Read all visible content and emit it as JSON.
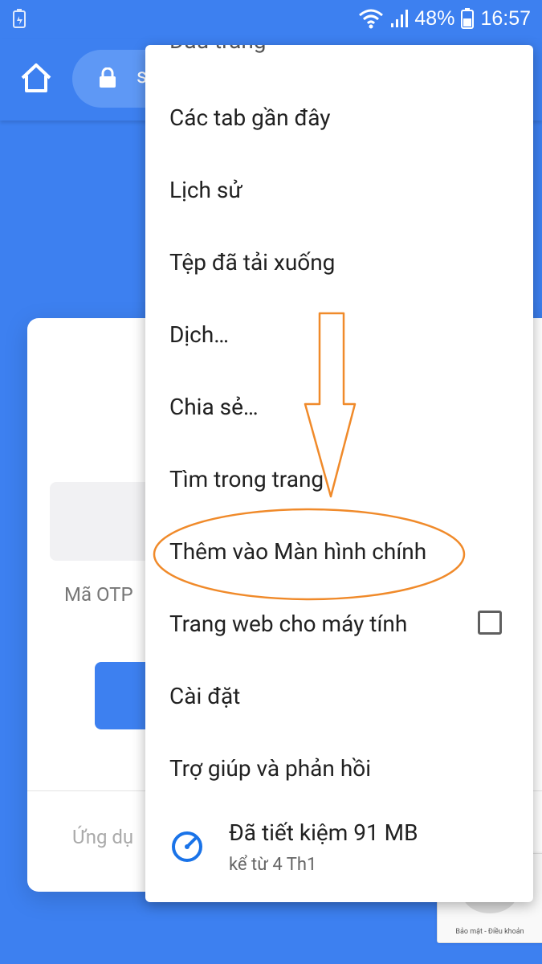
{
  "status_bar": {
    "battery": "48%",
    "time": "16:57"
  },
  "toolbar": {
    "url_fragment": "s"
  },
  "page": {
    "otp_label": "Mã OTP",
    "footer_text": "Ứng dụ"
  },
  "menu": {
    "partial_item": "Dấu trang",
    "items": [
      "Các tab gần đây",
      "Lịch sử",
      "Tệp đã tải xuống",
      "Dịch…",
      "Chia sẻ…",
      "Tìm trong trang",
      "Thêm vào Màn hình chính",
      "Trang web cho máy tính",
      "Cài đặt",
      "Trợ giúp và phản hồi"
    ],
    "savings_title": "Đã tiết kiệm 91 MB",
    "savings_subtitle": "kể từ 4 Th1"
  },
  "recaptcha": {
    "text": "Bảo mật - Điều khoản"
  },
  "colors": {
    "brand_blue": "#3d80f0",
    "annotation_orange": "#f08a2a"
  }
}
